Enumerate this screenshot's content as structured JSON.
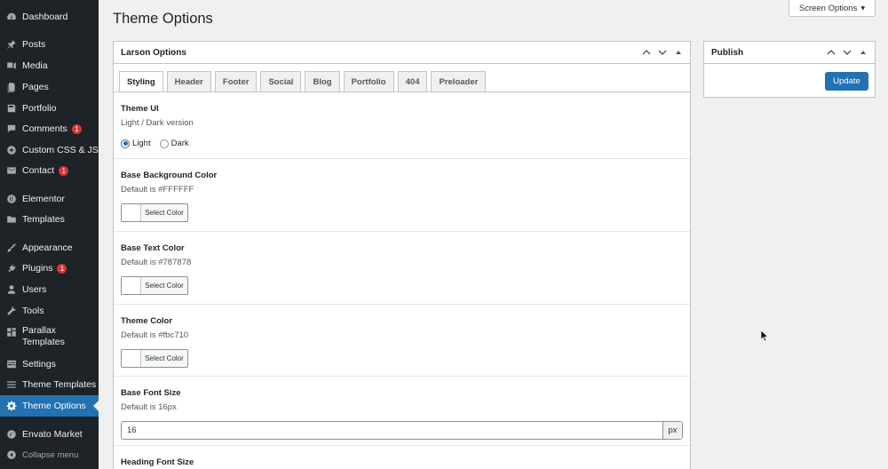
{
  "sidebar": {
    "items": [
      {
        "label": "Dashboard",
        "icon": "dashboard-icon"
      },
      {
        "label": "Posts",
        "icon": "pin-icon"
      },
      {
        "label": "Media",
        "icon": "media-icon"
      },
      {
        "label": "Pages",
        "icon": "pages-icon"
      },
      {
        "label": "Portfolio",
        "icon": "portfolio-icon"
      },
      {
        "label": "Comments",
        "icon": "comment-icon",
        "badge": "1"
      },
      {
        "label": "Custom CSS & JS",
        "icon": "plus-circle-icon"
      },
      {
        "label": "Contact",
        "icon": "mail-icon",
        "badge": "1"
      },
      {
        "label": "Elementor",
        "icon": "elementor-icon"
      },
      {
        "label": "Templates",
        "icon": "folder-icon"
      },
      {
        "label": "Appearance",
        "icon": "brush-icon"
      },
      {
        "label": "Plugins",
        "icon": "plugin-icon",
        "badge": "1"
      },
      {
        "label": "Users",
        "icon": "user-icon"
      },
      {
        "label": "Tools",
        "icon": "wrench-icon"
      },
      {
        "label": "Parallax Templates",
        "icon": "grid-icon"
      },
      {
        "label": "Settings",
        "icon": "settings-icon"
      },
      {
        "label": "Theme Templates",
        "icon": "list-icon"
      },
      {
        "label": "Theme Options",
        "icon": "gear-icon",
        "active": true
      },
      {
        "label": "Envato Market",
        "icon": "envato-icon"
      },
      {
        "label": "Collapse menu",
        "icon": "collapse-icon"
      }
    ]
  },
  "header": {
    "title": "Theme Options",
    "screen_options": "Screen Options",
    "screen_options_arrow": "▾"
  },
  "larson": {
    "title": "Larson Options",
    "tabs": [
      "Styling",
      "Header",
      "Footer",
      "Social",
      "Blog",
      "Portfolio",
      "404",
      "Preloader"
    ],
    "active_tab": "Styling",
    "fields": {
      "theme_ui": {
        "title": "Theme UI",
        "desc": "Light / Dark version",
        "options": [
          "Light",
          "Dark"
        ],
        "selected": "Light"
      },
      "bg_color": {
        "title": "Base Background Color",
        "desc": "Default is #FFFFFF",
        "button": "Select Color"
      },
      "text_color": {
        "title": "Base Text Color",
        "desc": "Default is #787878",
        "button": "Select Color"
      },
      "theme_color": {
        "title": "Theme Color",
        "desc": "Default is #fbc710",
        "button": "Select Color"
      },
      "font_size": {
        "title": "Base Font Size",
        "desc": "Default is 16px",
        "value": "16",
        "unit": "px"
      },
      "heading_size": {
        "title": "Heading Font Size"
      }
    }
  },
  "publish": {
    "title": "Publish",
    "update_label": "Update"
  },
  "colors": {
    "sidebar_bg": "#1d2327",
    "accent": "#2271b1",
    "badge": "#d63638",
    "page_bg": "#f0f0f1"
  }
}
